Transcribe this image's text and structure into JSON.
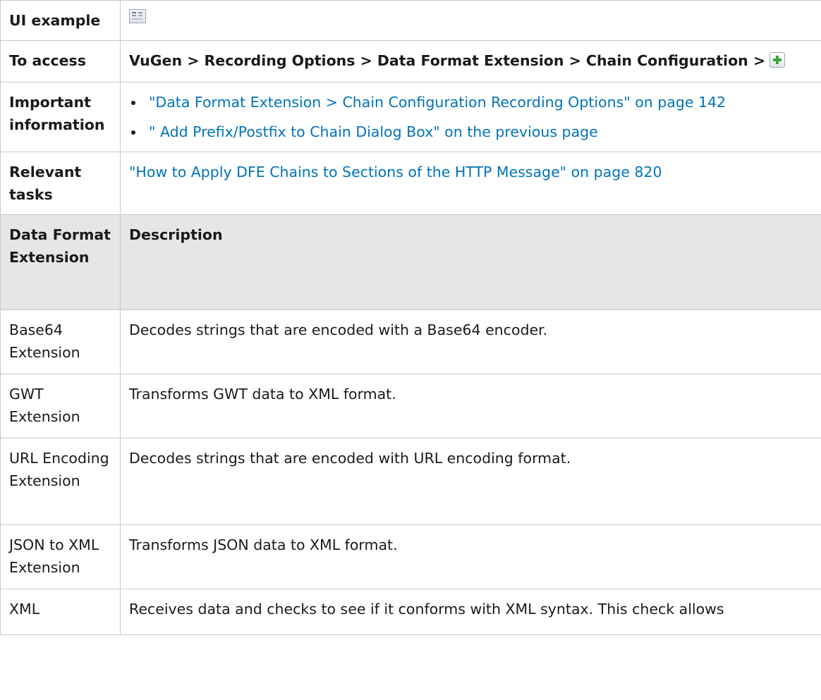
{
  "rows": {
    "ui_example": {
      "label": "UI example",
      "icon": "dialog-thumbnail-icon"
    },
    "to_access": {
      "label": "To access",
      "path": "VuGen > Recording Options > Data Format Extension > Chain Configuration >",
      "button_icon": "add-plus-icon"
    },
    "important": {
      "label": "Important information",
      "links": [
        "\"Data Format Extension > Chain Configuration Recording Options\" on page 142",
        "\" Add Prefix/Postfix to Chain Dialog Box\" on the previous page"
      ]
    },
    "tasks": {
      "label": "Relevant tasks",
      "link": "\"How to Apply DFE Chains to Sections of the HTTP Message\" on page 820"
    }
  },
  "table": {
    "headers": [
      "Data Format Extension",
      "Description"
    ],
    "rows": [
      {
        "name": "Base64 Extension",
        "description": "Decodes strings that are encoded with a Base64 encoder."
      },
      {
        "name": "GWT Extension",
        "description": "Transforms GWT data to XML format."
      },
      {
        "name": "URL Encoding Extension",
        "description": "Decodes strings that are encoded with URL encoding format."
      },
      {
        "name": "JSON to XML Extension",
        "description": "Transforms JSON data to XML format."
      },
      {
        "name": "XML",
        "description": "Receives data and checks to see if it conforms with XML syntax. This check allows"
      }
    ]
  },
  "colors": {
    "link": "#0073b7",
    "header_bg": "#e6e6e6",
    "border": "#c8c8c8",
    "plus": "#3ea33e"
  }
}
